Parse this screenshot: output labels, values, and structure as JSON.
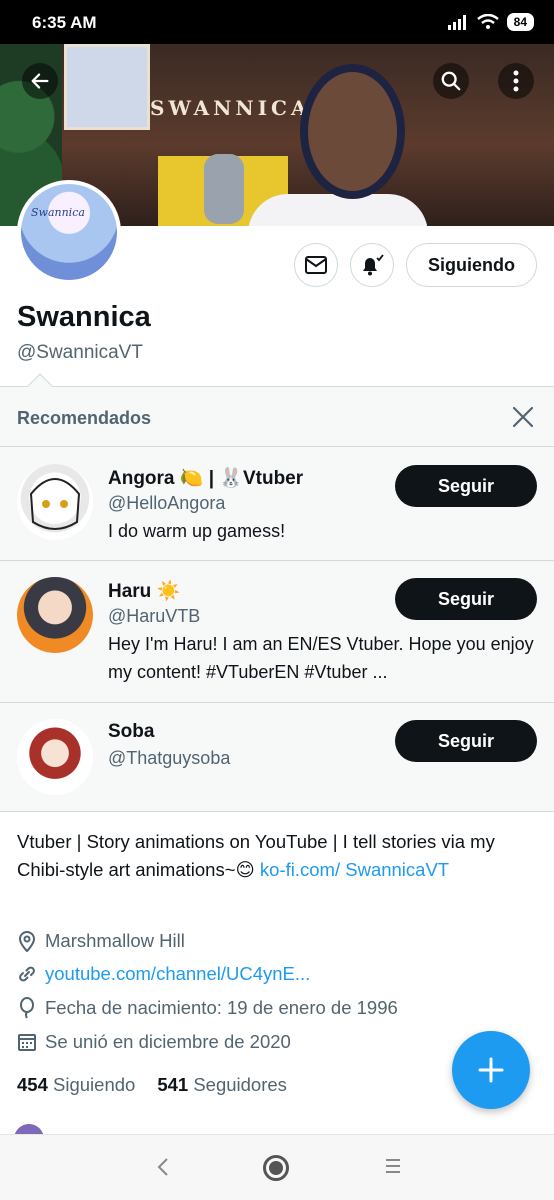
{
  "status_bar": {
    "time": "6:35 AM",
    "battery": "84"
  },
  "profile": {
    "name": "Swannica",
    "handle": "@SwannicaVT",
    "banner_text": "SWANNICA",
    "avatar_text": "Swannica",
    "following_button": "Siguiendo",
    "bio": "Vtuber | Story animations on YouTube | I tell stories via my Chibi-style art animations~😊",
    "bio_link": "ko-fi.com/\nSwannicaVT",
    "location": "Marshmallow Hill",
    "website": "youtube.com/channel/UC4ynE...",
    "birthday": "Fecha de nacimiento: 19 de enero de 1996",
    "joined": "Se unió en diciembre de 2020",
    "following_count": "454",
    "following_label": "Siguiendo",
    "followers_count": "541",
    "followers_label": "Seguidores"
  },
  "recommended": {
    "title": "Recomendados",
    "follow_label": "Seguir",
    "items": [
      {
        "name": "Angora 🍋 | 🐰Vtuber",
        "handle": "@HelloAngora",
        "bio": "I do warm up gamess!"
      },
      {
        "name": "Haru ☀️",
        "handle": "@HaruVTB",
        "bio": "Hey I'm Haru! I am an EN/ES Vtuber. Hope you enjoy my content! #VTuberEN #Vtuber ..."
      },
      {
        "name": "Soba",
        "handle": "@Thatguysoba",
        "bio": ""
      }
    ]
  },
  "colors": {
    "accent": "#1d9bf0",
    "text": "#0f1419",
    "secondary": "#536471"
  }
}
